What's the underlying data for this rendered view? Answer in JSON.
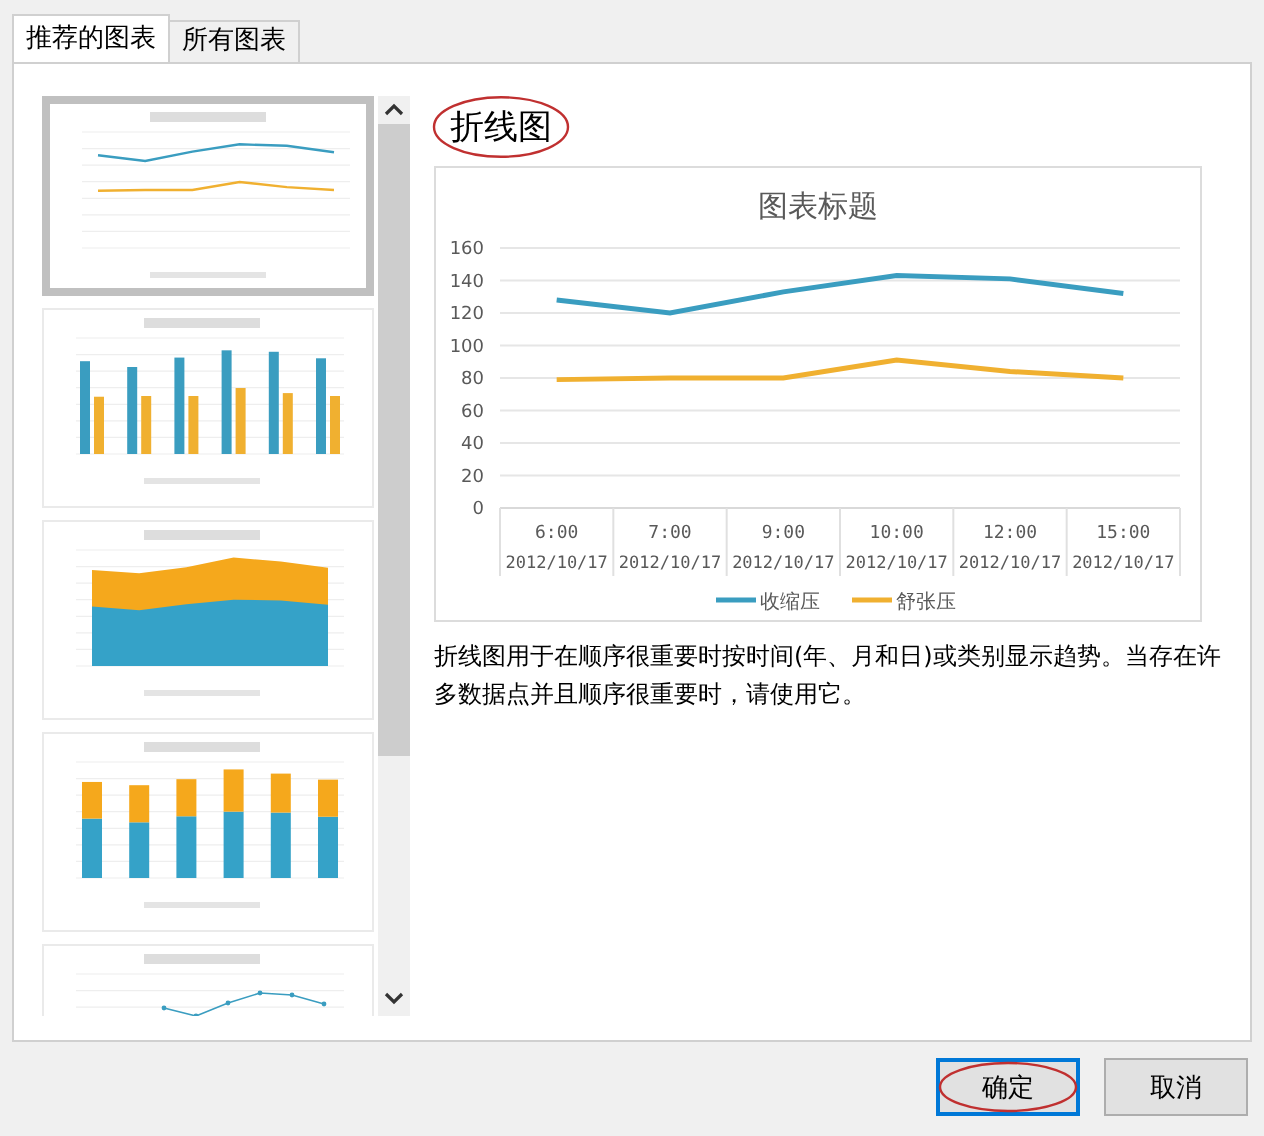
{
  "tabs": [
    {
      "label": "推荐的图表",
      "selected": true
    },
    {
      "label": "所有图表",
      "selected": false
    }
  ],
  "thumbnails": [
    {
      "kind": "line",
      "selected": true
    },
    {
      "kind": "bar",
      "selected": false
    },
    {
      "kind": "area",
      "selected": false
    },
    {
      "kind": "stacked",
      "selected": false
    },
    {
      "kind": "marker",
      "selected": false
    }
  ],
  "preview": {
    "name": "折线图",
    "chart_data": {
      "type": "line",
      "title": "图表标题",
      "categories": [
        "6:00 2012/10/17",
        "7:00 2012/10/17",
        "9:00 2012/10/17",
        "10:00 2012/10/17",
        "12:00 2012/10/17",
        "15:00 2012/10/17"
      ],
      "ylim": [
        0,
        160
      ],
      "grid": true,
      "legend": "bottom",
      "yticks": [
        0,
        20,
        40,
        60,
        80,
        100,
        120,
        140,
        160
      ],
      "series": [
        {
          "name": "收缩压",
          "color": "#3a9dc0",
          "values": [
            128,
            120,
            133,
            143,
            141,
            132
          ]
        },
        {
          "name": "舒张压",
          "color": "#f0b030",
          "values": [
            79,
            80,
            80,
            91,
            84,
            80
          ]
        }
      ]
    },
    "description": "折线图用于在顺序很重要时按时间(年、月和日)或类别显示趋势。当存在许多数据点并且顺序很重要时，请使用它。"
  },
  "buttons": [
    {
      "label": "确定",
      "selected": true
    },
    {
      "label": "取消",
      "selected": false
    }
  ]
}
